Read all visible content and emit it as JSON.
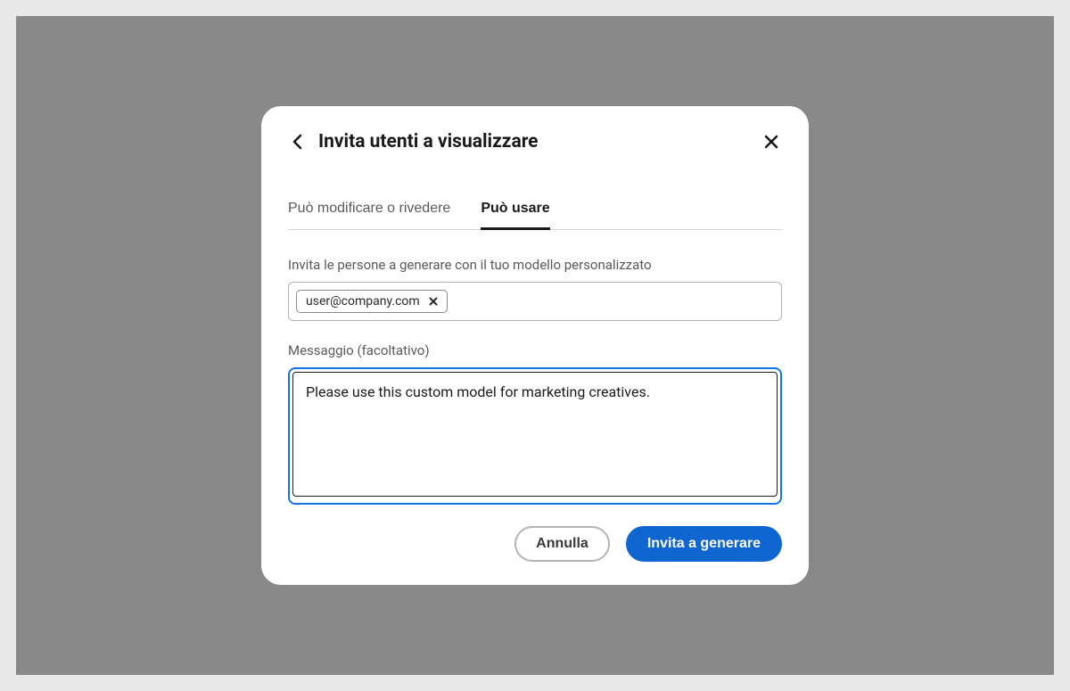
{
  "dialog": {
    "title": "Invita utenti a visualizzare",
    "tabs": [
      {
        "label": "Può modificare o rivedere",
        "active": false
      },
      {
        "label": "Può usare",
        "active": true
      }
    ],
    "invite": {
      "label": "Invita le persone a generare con il tuo modello personalizzato",
      "chips": [
        {
          "email": "user@company.com"
        }
      ],
      "input_value": ""
    },
    "message": {
      "label": "Messaggio (facoltativo)",
      "value": "Please use this custom model for marketing creatives."
    },
    "footer": {
      "cancel_label": "Annulla",
      "submit_label": "Invita a generare"
    }
  }
}
